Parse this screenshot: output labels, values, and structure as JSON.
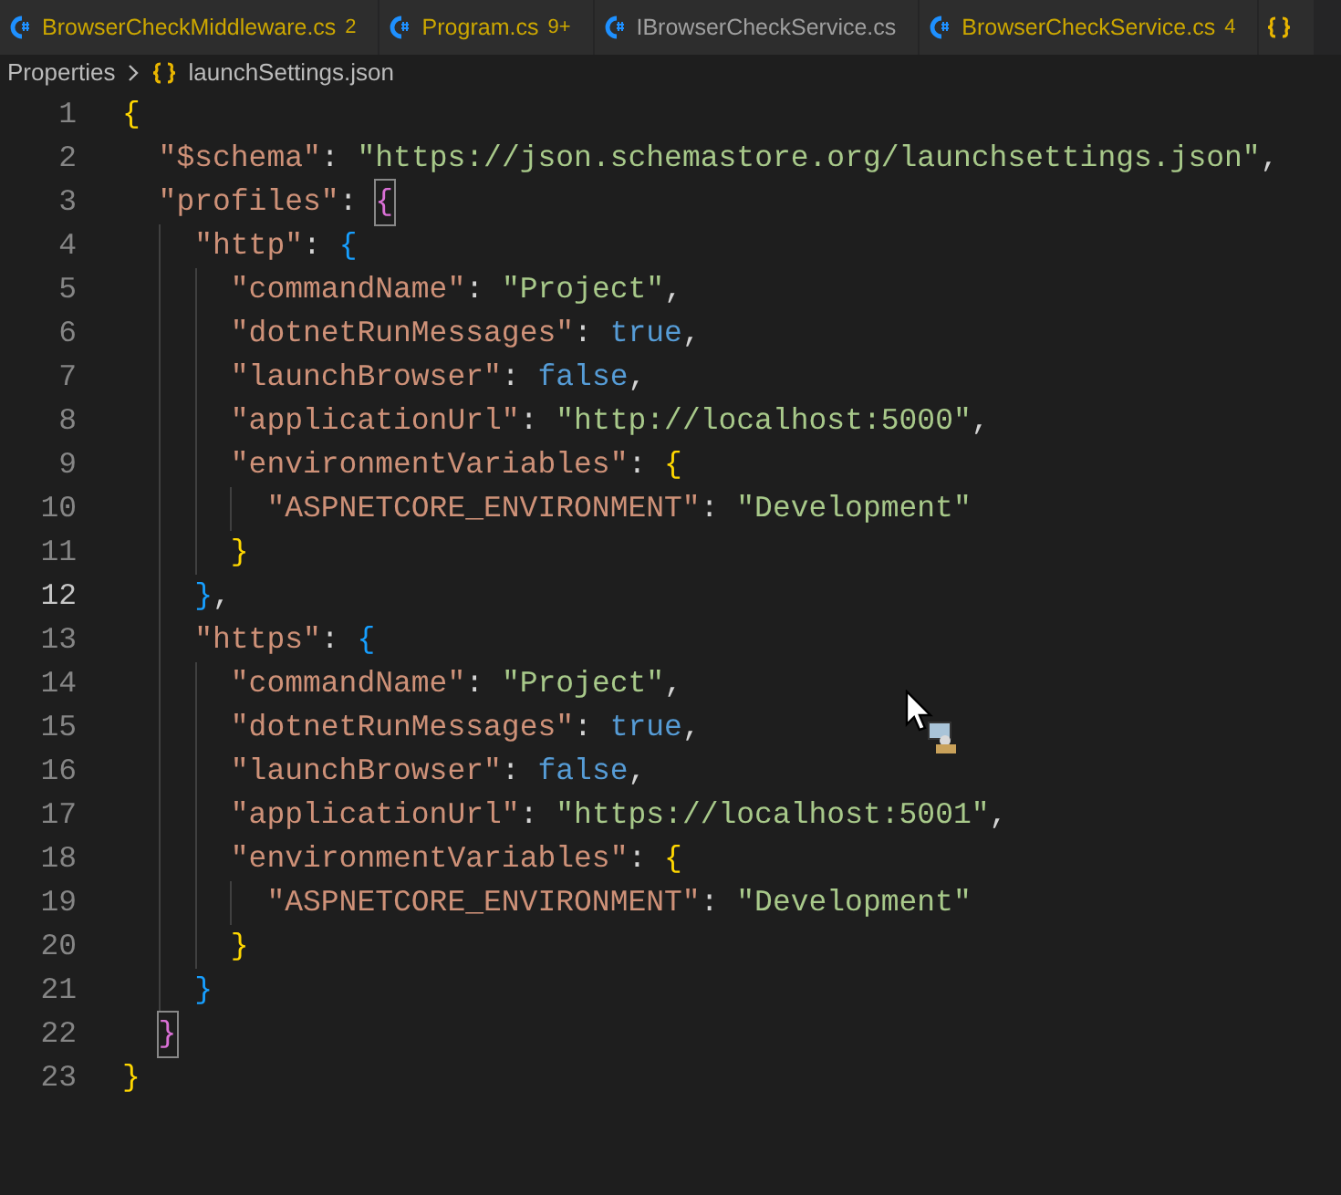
{
  "tabs": [
    {
      "label": "BrowserCheckMiddleware.cs",
      "badge": "2",
      "warning": true,
      "kind": "csharp"
    },
    {
      "label": "Program.cs",
      "badge": "9+",
      "warning": true,
      "kind": "csharp"
    },
    {
      "label": "IBrowserCheckService.cs",
      "warning": false,
      "kind": "csharp"
    },
    {
      "label": "BrowserCheckService.cs",
      "badge": "4",
      "warning": true,
      "kind": "csharp"
    },
    {
      "kind": "json"
    }
  ],
  "breadcrumb": {
    "folder": "Properties",
    "file": "launchSettings.json"
  },
  "editor": {
    "line_numbers": [
      {
        "text": "1",
        "active": false
      },
      {
        "text": "2",
        "active": false
      },
      {
        "text": "3",
        "active": false
      },
      {
        "text": "4",
        "active": false
      },
      {
        "text": "5",
        "active": false
      },
      {
        "text": "6",
        "active": false
      },
      {
        "text": "7",
        "active": false
      },
      {
        "text": "8",
        "active": false
      },
      {
        "text": "9",
        "active": false
      },
      {
        "text": "10",
        "active": false
      },
      {
        "text": "11",
        "active": false
      },
      {
        "text": "12",
        "active": true
      },
      {
        "text": "13",
        "active": false
      },
      {
        "text": "14",
        "active": false
      },
      {
        "text": "15",
        "active": false
      },
      {
        "text": "16",
        "active": false
      },
      {
        "text": "17",
        "active": false
      },
      {
        "text": "18",
        "active": false
      },
      {
        "text": "19",
        "active": false
      },
      {
        "text": "20",
        "active": false
      },
      {
        "text": "21",
        "active": false
      },
      {
        "text": "22",
        "active": false
      },
      {
        "text": "23",
        "active": false
      }
    ],
    "lines": [
      [
        {
          "kind": "bracket",
          "text": "{",
          "color": "#ffd700"
        }
      ],
      [
        {
          "kind": "key",
          "text": "\"$schema\""
        },
        {
          "kind": "punct",
          "text": ": "
        },
        {
          "kind": "string",
          "text": "\"https://json.schemastore.org/launchsettings.json\""
        },
        {
          "kind": "punct",
          "text": ","
        }
      ],
      [
        {
          "kind": "key",
          "text": "\"profiles\""
        },
        {
          "kind": "punct",
          "text": ": "
        },
        {
          "kind": "bracket",
          "text": "{",
          "color": "#da70d6",
          "matched": true
        }
      ],
      [
        {
          "kind": "key",
          "text": "\"http\""
        },
        {
          "kind": "punct",
          "text": ": "
        },
        {
          "kind": "bracket",
          "text": "{",
          "color": "#179fff"
        }
      ],
      [
        {
          "kind": "key",
          "text": "\"commandName\""
        },
        {
          "kind": "punct",
          "text": ": "
        },
        {
          "kind": "string",
          "text": "\"Project\""
        },
        {
          "kind": "punct",
          "text": ","
        }
      ],
      [
        {
          "kind": "key",
          "text": "\"dotnetRunMessages\""
        },
        {
          "kind": "punct",
          "text": ": "
        },
        {
          "kind": "literal",
          "text": "true"
        },
        {
          "kind": "punct",
          "text": ","
        }
      ],
      [
        {
          "kind": "key",
          "text": "\"launchBrowser\""
        },
        {
          "kind": "punct",
          "text": ": "
        },
        {
          "kind": "literal",
          "text": "false"
        },
        {
          "kind": "punct",
          "text": ","
        }
      ],
      [
        {
          "kind": "key",
          "text": "\"applicationUrl\""
        },
        {
          "kind": "punct",
          "text": ": "
        },
        {
          "kind": "string",
          "text": "\"http://localhost:5000\""
        },
        {
          "kind": "punct",
          "text": ","
        }
      ],
      [
        {
          "kind": "key",
          "text": "\"environmentVariables\""
        },
        {
          "kind": "punct",
          "text": ": "
        },
        {
          "kind": "bracket",
          "text": "{",
          "color": "#ffd700"
        }
      ],
      [
        {
          "kind": "key",
          "text": "\"ASPNETCORE_ENVIRONMENT\""
        },
        {
          "kind": "punct",
          "text": ": "
        },
        {
          "kind": "string",
          "text": "\"Development\""
        }
      ],
      [
        {
          "kind": "bracket",
          "text": "}",
          "color": "#ffd700"
        }
      ],
      [
        {
          "kind": "bracket",
          "text": "}",
          "color": "#179fff"
        },
        {
          "kind": "punct",
          "text": ","
        }
      ],
      [
        {
          "kind": "key",
          "text": "\"https\""
        },
        {
          "kind": "punct",
          "text": ": "
        },
        {
          "kind": "bracket",
          "text": "{",
          "color": "#179fff"
        }
      ],
      [
        {
          "kind": "key",
          "text": "\"commandName\""
        },
        {
          "kind": "punct",
          "text": ": "
        },
        {
          "kind": "string",
          "text": "\"Project\""
        },
        {
          "kind": "punct",
          "text": ","
        }
      ],
      [
        {
          "kind": "key",
          "text": "\"dotnetRunMessages\""
        },
        {
          "kind": "punct",
          "text": ": "
        },
        {
          "kind": "literal",
          "text": "true"
        },
        {
          "kind": "punct",
          "text": ","
        }
      ],
      [
        {
          "kind": "key",
          "text": "\"launchBrowser\""
        },
        {
          "kind": "punct",
          "text": ": "
        },
        {
          "kind": "literal",
          "text": "false"
        },
        {
          "kind": "punct",
          "text": ","
        }
      ],
      [
        {
          "kind": "key",
          "text": "\"applicationUrl\""
        },
        {
          "kind": "punct",
          "text": ": "
        },
        {
          "kind": "string",
          "text": "\"https://localhost:5001\""
        },
        {
          "kind": "punct",
          "text": ","
        }
      ],
      [
        {
          "kind": "key",
          "text": "\"environmentVariables\""
        },
        {
          "kind": "punct",
          "text": ": "
        },
        {
          "kind": "bracket",
          "text": "{",
          "color": "#ffd700"
        }
      ],
      [
        {
          "kind": "key",
          "text": "\"ASPNETCORE_ENVIRONMENT\""
        },
        {
          "kind": "punct",
          "text": ": "
        },
        {
          "kind": "string",
          "text": "\"Development\""
        }
      ],
      [
        {
          "kind": "bracket",
          "text": "}",
          "color": "#ffd700"
        }
      ],
      [
        {
          "kind": "bracket",
          "text": "}",
          "color": "#179fff"
        }
      ],
      [
        {
          "kind": "bracket",
          "text": "}",
          "color": "#da70d6",
          "matched": true
        }
      ],
      [
        {
          "kind": "bracket",
          "text": "}",
          "color": "#ffd700"
        }
      ]
    ]
  }
}
